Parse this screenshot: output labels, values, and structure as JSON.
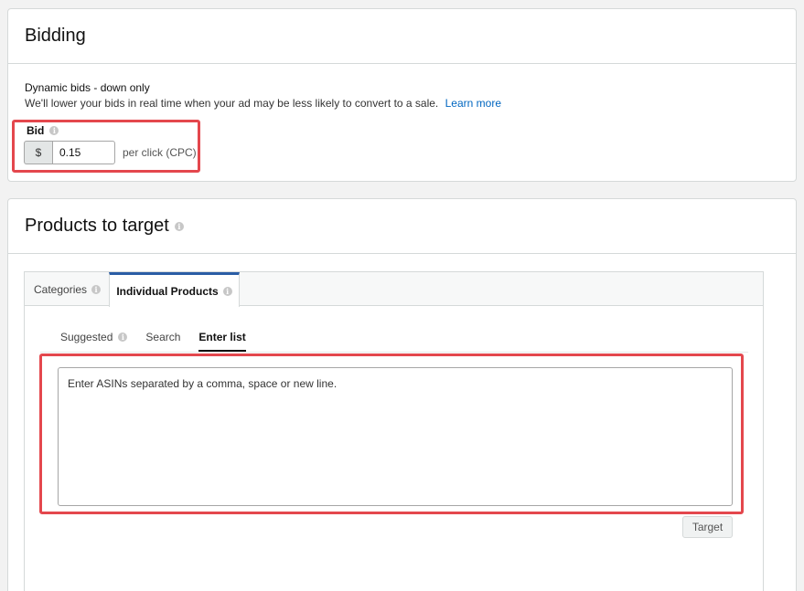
{
  "bidding": {
    "title": "Bidding",
    "strategy": "Dynamic bids - down only",
    "description": "We'll lower your bids in real time when your ad may be less likely to convert to a sale.",
    "learn_more": "Learn more",
    "bid_label": "Bid",
    "currency": "$",
    "bid_value": "0.15",
    "per_click": "per click (CPC)"
  },
  "products": {
    "title": "Products to target",
    "tabs": [
      {
        "label": "Categories"
      },
      {
        "label": "Individual Products"
      }
    ],
    "subtabs": [
      {
        "label": "Suggested"
      },
      {
        "label": "Search"
      },
      {
        "label": "Enter list"
      }
    ],
    "asin_placeholder": "Enter ASINs separated by a comma, space or new line.",
    "target_button": "Target"
  },
  "colors": {
    "highlight": "#e4474d",
    "link": "#0066c0",
    "active_tab": "#2a5da5"
  },
  "icons": {
    "info": "info-icon"
  }
}
